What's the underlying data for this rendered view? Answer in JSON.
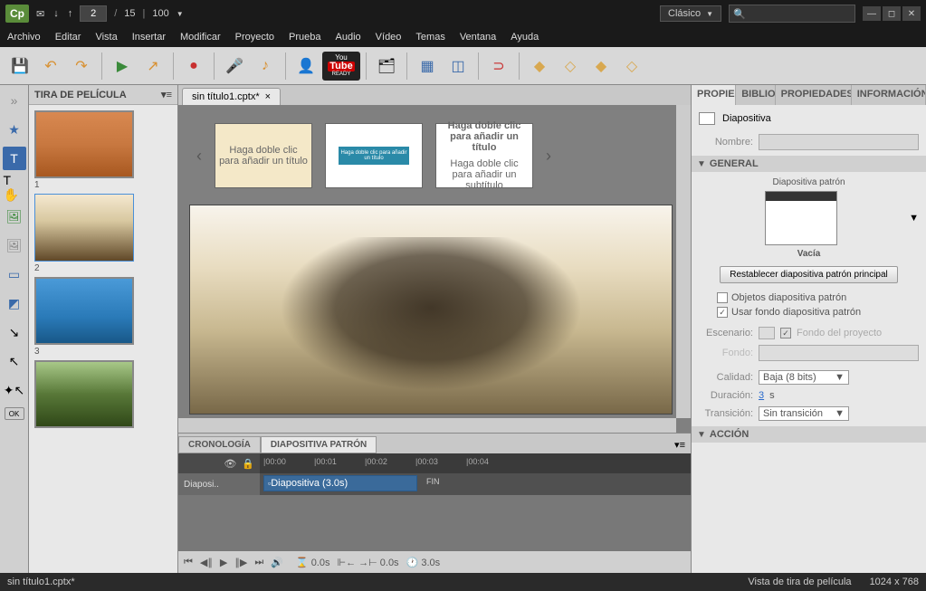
{
  "app": {
    "logo": "Cp"
  },
  "titlebar": {
    "page_current": "2",
    "page_sep": "/",
    "page_total": "15",
    "zoom": "100",
    "workspace": "Clásico"
  },
  "menu": [
    "Archivo",
    "Editar",
    "Vista",
    "Insertar",
    "Modificar",
    "Proyecto",
    "Prueba",
    "Audio",
    "Vídeo",
    "Temas",
    "Ventana",
    "Ayuda"
  ],
  "filmstrip": {
    "title": "TIRA DE PELÍCULA",
    "slides": [
      {
        "n": "1"
      },
      {
        "n": "2"
      },
      {
        "n": "3"
      },
      {
        "n": ""
      }
    ]
  },
  "doc": {
    "tab": "sin título1.cptx*",
    "close": "×"
  },
  "templates": {
    "t1": "Haga doble clic para añadir un título",
    "t2": "Haga doble clic para añadir un título",
    "t3a": "Haga doble clic para añadir un título",
    "t3b": "Haga doble clic para añadir un subtítulo"
  },
  "timeline": {
    "tabs": [
      "CRONOLOGÍA",
      "DIAPOSITIVA PATRÓN"
    ],
    "ticks": [
      "|00:00",
      "|00:01",
      "|00:02",
      "|00:03",
      "|00:04"
    ],
    "row_label": "Diaposi..",
    "clip": "Diapositiva (3.0s)",
    "end": "FIN",
    "ctrl_time1": "0.0s",
    "ctrl_time2": "0.0s",
    "ctrl_time3": "3.0s"
  },
  "props": {
    "tabs": [
      "PROPIEDADES",
      "BIBLIOTECA",
      "PROPIEDADES DE LAS PRUE",
      "INFORMACIÓN DEL PROYEC"
    ],
    "title": "Diapositiva",
    "name_label": "Nombre:",
    "sections": {
      "general": "GENERAL",
      "accion": "ACCIÓN"
    },
    "master_label": "Diapositiva patrón",
    "master_name": "Vacía",
    "reset_btn": "Restablecer diapositiva patrón principal",
    "chk1": "Objetos diapositiva patrón",
    "chk2": "Usar fondo diapositiva patrón",
    "escenario_lbl": "Escenario:",
    "fondo_proyecto": "Fondo del proyecto",
    "fondo_lbl": "Fondo:",
    "calidad_lbl": "Calidad:",
    "calidad_val": "Baja (8 bits)",
    "duracion_lbl": "Duración:",
    "duracion_val": "3",
    "duracion_unit": " s",
    "transicion_lbl": "Transición:",
    "transicion_val": "Sin transición"
  },
  "status": {
    "file": "sin título1.cptx*",
    "view": "Vista de tira de película",
    "dims": "1024 x 768"
  }
}
